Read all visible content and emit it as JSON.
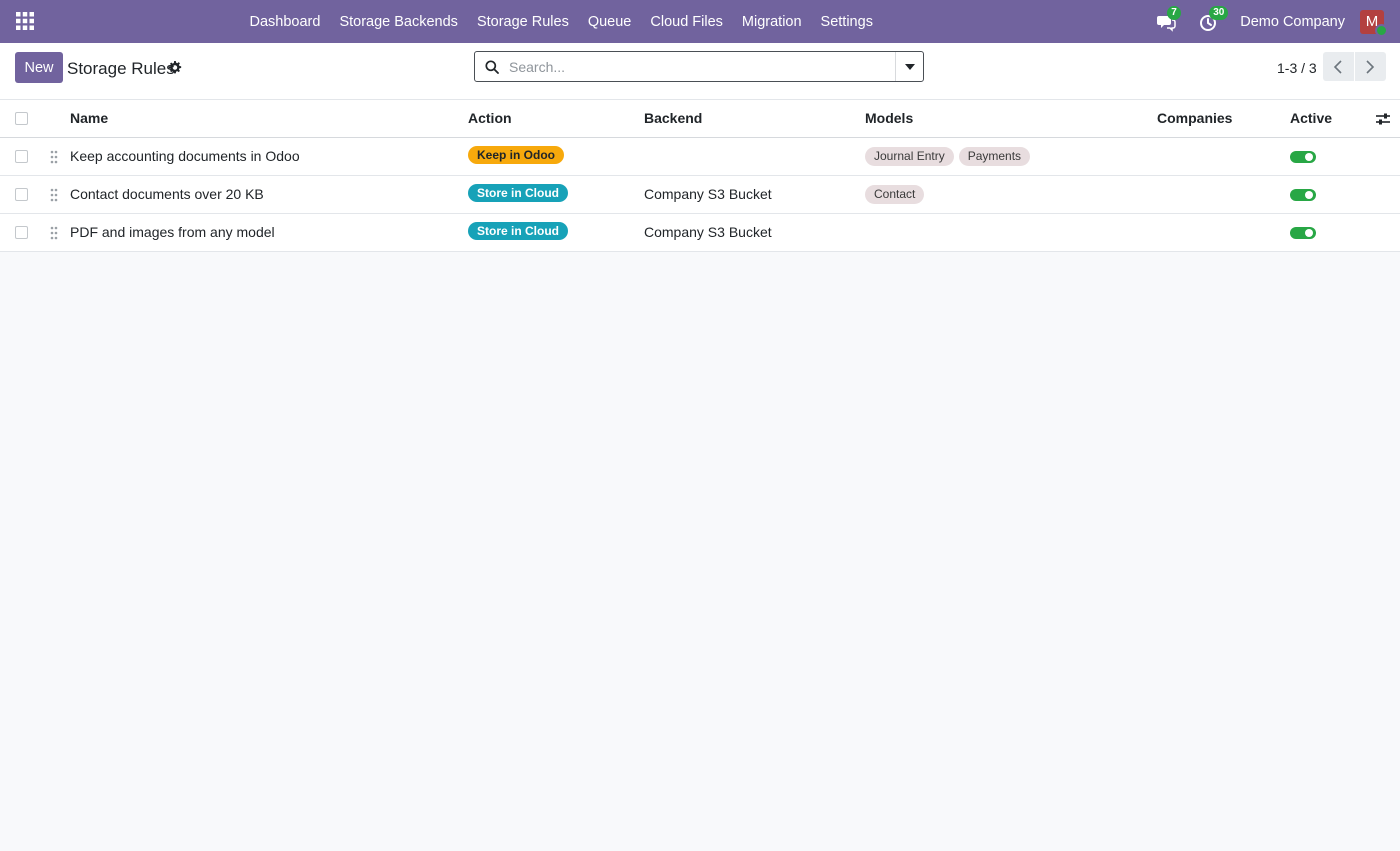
{
  "navbar": {
    "menu": [
      "Dashboard",
      "Storage Backends",
      "Storage Rules",
      "Queue",
      "Cloud Files",
      "Migration",
      "Settings"
    ],
    "messages_count": "7",
    "activities_count": "30",
    "company": "Demo Company",
    "avatar_letter": "M",
    "color": "#71639e"
  },
  "control": {
    "new_label": "New",
    "title": "Storage Rules",
    "search_placeholder": "Search...",
    "pager": "1-3 / 3"
  },
  "table": {
    "columns": {
      "name": "Name",
      "action": "Action",
      "backend": "Backend",
      "models": "Models",
      "companies": "Companies",
      "active": "Active"
    },
    "rows": [
      {
        "name": "Keep accounting documents in Odoo",
        "action": "Keep in Odoo",
        "action_color": "#f7a90c",
        "backend": "",
        "models": [
          "Journal Entry",
          "Payments"
        ],
        "active": true
      },
      {
        "name": "Contact documents over 20 KB",
        "action": "Store in Cloud",
        "action_color": "#17a2b8",
        "backend": "Company S3 Bucket",
        "models": [
          "Contact"
        ],
        "active": true
      },
      {
        "name": "PDF and images from any model",
        "action": "Store in Cloud",
        "action_color": "#17a2b8",
        "backend": "Company S3 Bucket",
        "models": [],
        "active": true
      }
    ]
  }
}
